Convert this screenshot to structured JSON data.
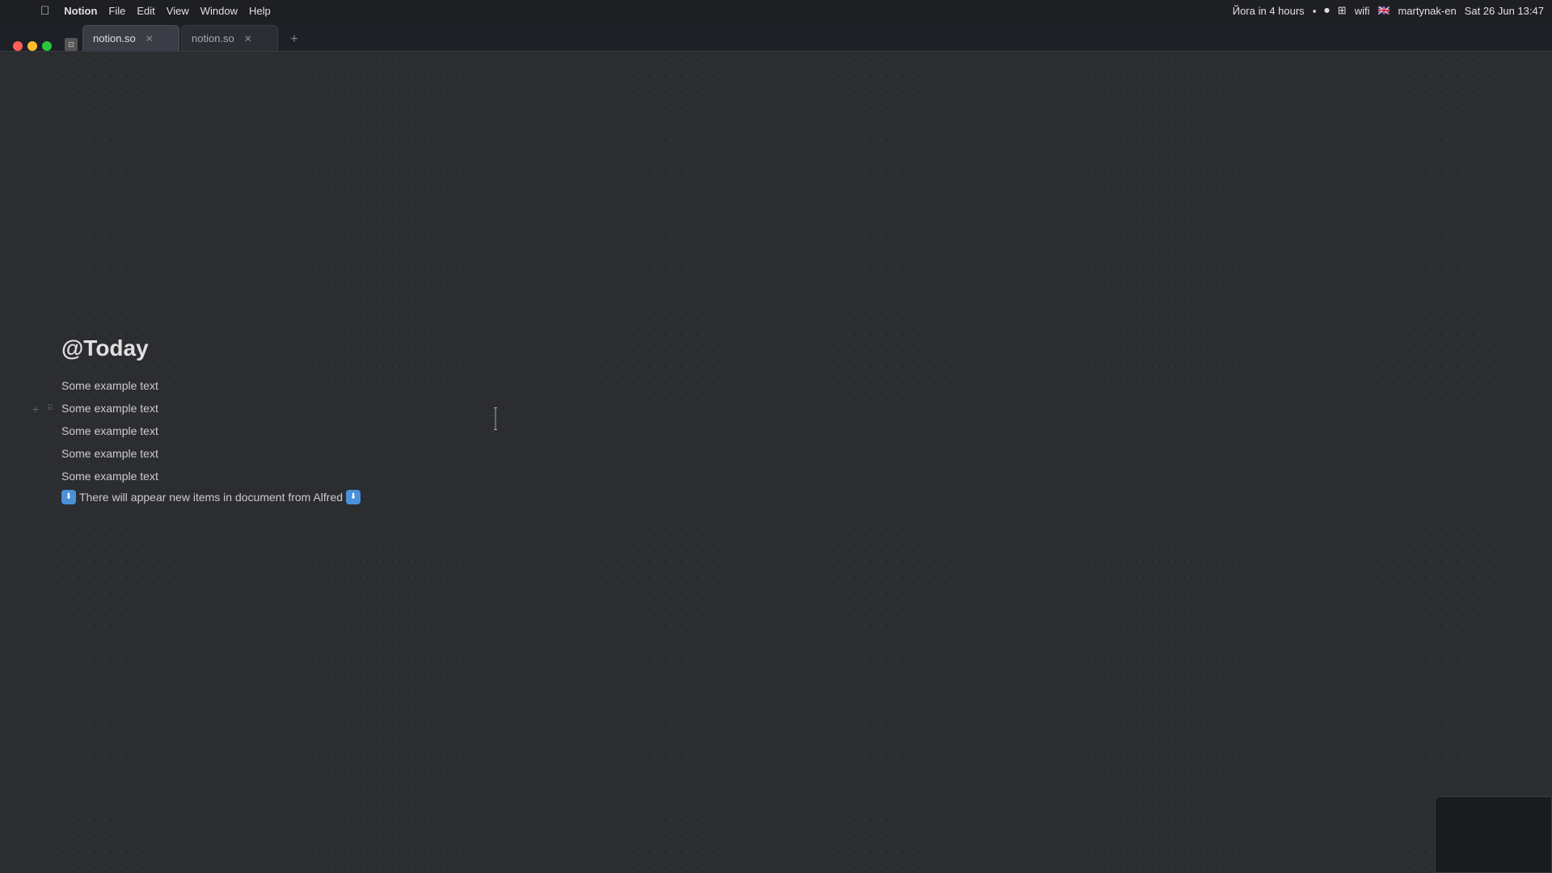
{
  "app": {
    "name": "Notion"
  },
  "menubar": {
    "apple": "⌘",
    "items": [
      "Notion",
      "File",
      "Edit",
      "View",
      "Window",
      "Help"
    ],
    "right": {
      "reminder": "Йога in 4 hours",
      "datetime": "Sat 26 Jun  13:47",
      "username": "martynak-en"
    }
  },
  "tabbar": {
    "tabs": [
      {
        "label": "notion.so",
        "active": true
      },
      {
        "label": "notion.so",
        "active": false
      }
    ],
    "new_tab_label": "+"
  },
  "page": {
    "title": "@Today",
    "blocks": [
      {
        "text": "Some example text",
        "hovered": false
      },
      {
        "text": "Some example text",
        "hovered": true
      },
      {
        "text": "Some example text",
        "hovered": false
      },
      {
        "text": "Some example text",
        "hovered": false
      },
      {
        "text": "Some example text",
        "hovered": false
      }
    ],
    "alfred_line": {
      "text": "There will appear new items in document from Alfred"
    }
  },
  "icons": {
    "add": "+",
    "drag": "⠿",
    "alfred": "⬇",
    "cursor": "𝙸"
  }
}
